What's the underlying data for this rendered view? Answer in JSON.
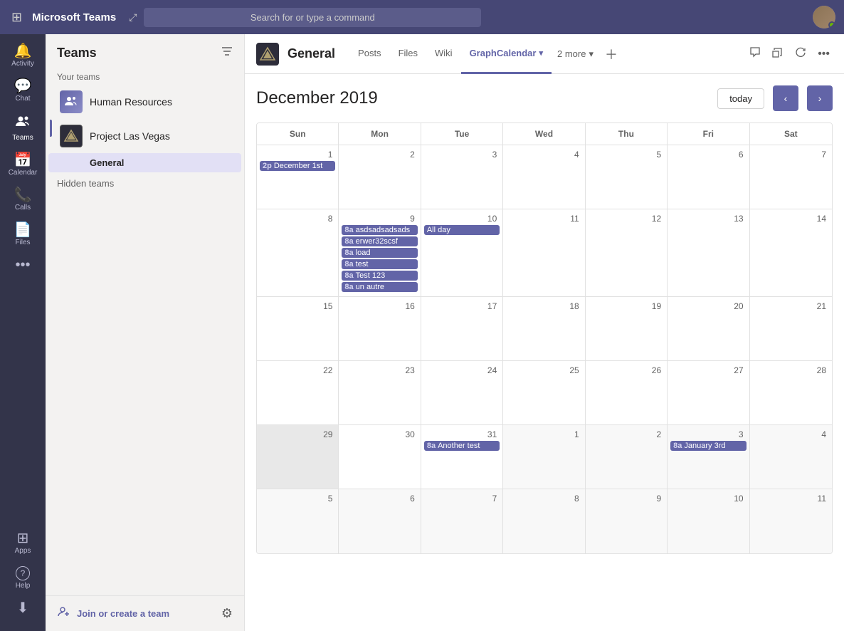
{
  "topbar": {
    "title": "Microsoft Teams",
    "search_placeholder": "Search for or type a command"
  },
  "sidebar": {
    "items": [
      {
        "id": "activity",
        "label": "Activity",
        "icon": "🔔"
      },
      {
        "id": "chat",
        "label": "Chat",
        "icon": "💬"
      },
      {
        "id": "teams",
        "label": "Teams",
        "icon": "👥",
        "active": true
      },
      {
        "id": "calendar",
        "label": "Calendar",
        "icon": "📅"
      },
      {
        "id": "calls",
        "label": "Calls",
        "icon": "📞"
      },
      {
        "id": "files",
        "label": "Files",
        "icon": "📄"
      },
      {
        "id": "more",
        "label": "...",
        "icon": "···"
      }
    ],
    "bottom_items": [
      {
        "id": "apps",
        "label": "Apps",
        "icon": "⊞"
      },
      {
        "id": "help",
        "label": "Help",
        "icon": "?"
      },
      {
        "id": "download",
        "label": "",
        "icon": "⬇"
      }
    ]
  },
  "teams_panel": {
    "title": "Teams",
    "your_teams_label": "Your teams",
    "teams": [
      {
        "id": "hr",
        "name": "Human Resources",
        "avatar_type": "hr"
      },
      {
        "id": "plv",
        "name": "Project Las Vegas",
        "avatar_type": "plv"
      }
    ],
    "channels": [
      {
        "id": "general",
        "name": "General",
        "team_id": "plv",
        "active": true
      }
    ],
    "hidden_teams_label": "Hidden teams",
    "footer": {
      "join_label": "Join or create a team"
    }
  },
  "channel": {
    "name": "General",
    "tabs": [
      {
        "id": "posts",
        "label": "Posts"
      },
      {
        "id": "files",
        "label": "Files"
      },
      {
        "id": "wiki",
        "label": "Wiki"
      },
      {
        "id": "graph_calendar",
        "label": "GraphCalendar",
        "active": true
      }
    ],
    "more_label": "2 more"
  },
  "calendar": {
    "month_title": "December 2019",
    "today_btn": "today",
    "days_of_week": [
      "Sun",
      "Mon",
      "Tue",
      "Wed",
      "Thu",
      "Fri",
      "Sat"
    ],
    "weeks": [
      {
        "days": [
          {
            "date": 1,
            "month": "current",
            "events": [
              {
                "time": "2p",
                "title": "December 1st",
                "type": "normal"
              }
            ]
          },
          {
            "date": 2,
            "month": "current",
            "events": []
          },
          {
            "date": 3,
            "month": "current",
            "events": []
          },
          {
            "date": 4,
            "month": "current",
            "events": []
          },
          {
            "date": 5,
            "month": "current",
            "events": []
          },
          {
            "date": 6,
            "month": "current",
            "events": []
          },
          {
            "date": 7,
            "month": "current",
            "events": []
          }
        ]
      },
      {
        "days": [
          {
            "date": 8,
            "month": "current",
            "events": []
          },
          {
            "date": 9,
            "month": "current",
            "events": [
              {
                "time": "8a",
                "title": "asdsadsadsads",
                "type": "normal"
              },
              {
                "time": "8a",
                "title": "erwer32scsf",
                "type": "normal"
              },
              {
                "time": "8a",
                "title": "load",
                "type": "normal"
              },
              {
                "time": "8a",
                "title": "test",
                "type": "normal"
              },
              {
                "time": "8a",
                "title": "Test 123",
                "type": "normal"
              },
              {
                "time": "8a",
                "title": "un autre",
                "type": "normal"
              }
            ]
          },
          {
            "date": 10,
            "month": "current",
            "events": [
              {
                "time": "",
                "title": "All day",
                "type": "allday"
              }
            ]
          },
          {
            "date": 11,
            "month": "current",
            "events": []
          },
          {
            "date": 12,
            "month": "current",
            "events": []
          },
          {
            "date": 13,
            "month": "current",
            "events": []
          },
          {
            "date": 14,
            "month": "current",
            "events": []
          }
        ]
      },
      {
        "days": [
          {
            "date": 15,
            "month": "current",
            "events": []
          },
          {
            "date": 16,
            "month": "current",
            "events": []
          },
          {
            "date": 17,
            "month": "current",
            "events": []
          },
          {
            "date": 18,
            "month": "current",
            "events": []
          },
          {
            "date": 19,
            "month": "current",
            "events": []
          },
          {
            "date": 20,
            "month": "current",
            "events": []
          },
          {
            "date": 21,
            "month": "current",
            "events": []
          }
        ]
      },
      {
        "days": [
          {
            "date": 22,
            "month": "current",
            "events": []
          },
          {
            "date": 23,
            "month": "current",
            "events": []
          },
          {
            "date": 24,
            "month": "current",
            "events": []
          },
          {
            "date": 25,
            "month": "current",
            "events": []
          },
          {
            "date": 26,
            "month": "current",
            "events": []
          },
          {
            "date": 27,
            "month": "current",
            "events": []
          },
          {
            "date": 28,
            "month": "current",
            "events": []
          }
        ]
      },
      {
        "days": [
          {
            "date": 29,
            "month": "current",
            "greyed": true,
            "events": []
          },
          {
            "date": 30,
            "month": "current",
            "events": []
          },
          {
            "date": 31,
            "month": "current",
            "events": [
              {
                "time": "8a",
                "title": "Another test",
                "type": "normal"
              }
            ]
          },
          {
            "date": 1,
            "month": "next",
            "events": []
          },
          {
            "date": 2,
            "month": "next",
            "events": []
          },
          {
            "date": 3,
            "month": "next",
            "events": [
              {
                "time": "8a",
                "title": "January 3rd",
                "type": "normal"
              }
            ]
          },
          {
            "date": 4,
            "month": "next",
            "events": []
          }
        ]
      },
      {
        "days": [
          {
            "date": 5,
            "month": "next",
            "events": []
          },
          {
            "date": 6,
            "month": "next",
            "events": []
          },
          {
            "date": 7,
            "month": "next",
            "events": []
          },
          {
            "date": 8,
            "month": "next",
            "events": []
          },
          {
            "date": 9,
            "month": "next",
            "events": []
          },
          {
            "date": 10,
            "month": "next",
            "events": []
          },
          {
            "date": 11,
            "month": "next",
            "events": []
          }
        ]
      }
    ]
  }
}
